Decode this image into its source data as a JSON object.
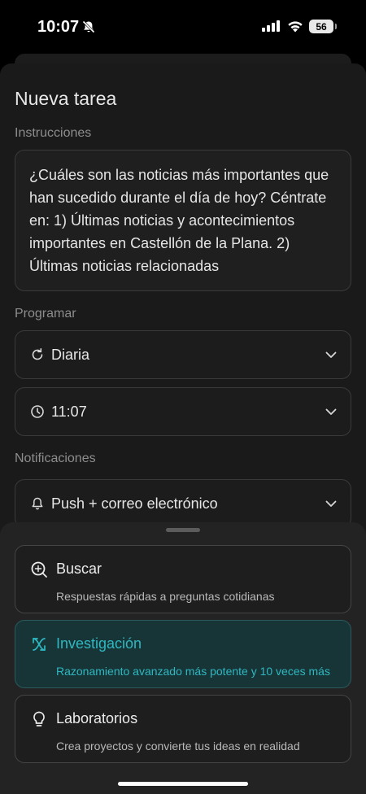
{
  "status_bar": {
    "time": "10:07",
    "battery": "56",
    "icons": [
      "bell-off-icon",
      "signal-icon",
      "wifi-icon",
      "battery-icon"
    ]
  },
  "task": {
    "title": "Nueva tarea",
    "instructions_label": "Instrucciones",
    "instructions_text": "¿Cuáles son las noticias más importantes que han sucedido durante el día de hoy? Céntrate en: 1) Últimas noticias y acontecimientos importantes en Castellón de la Plana. 2) Últimas noticias relacionadas",
    "schedule_label": "Programar",
    "frequency": "Diaria",
    "time": "11:07",
    "notifications_label": "Notificaciones",
    "notification_method": "Push + correo electrónico"
  },
  "modes": [
    {
      "title": "Buscar",
      "description": "Respuestas rápidas a preguntas cotidianas",
      "icon": "search-sparkle-icon",
      "active": false
    },
    {
      "title": "Investigación",
      "description": "Razonamiento avanzado más potente y 10 veces más",
      "icon": "research-icon",
      "active": true
    },
    {
      "title": "Laboratorios",
      "description": "Crea proyectos y convierte tus ideas en realidad",
      "icon": "lightbulb-icon",
      "active": false
    }
  ],
  "colors": {
    "accent": "#2fb8c1",
    "active_card_bg": "#173437",
    "background": "#1a1a1a"
  }
}
